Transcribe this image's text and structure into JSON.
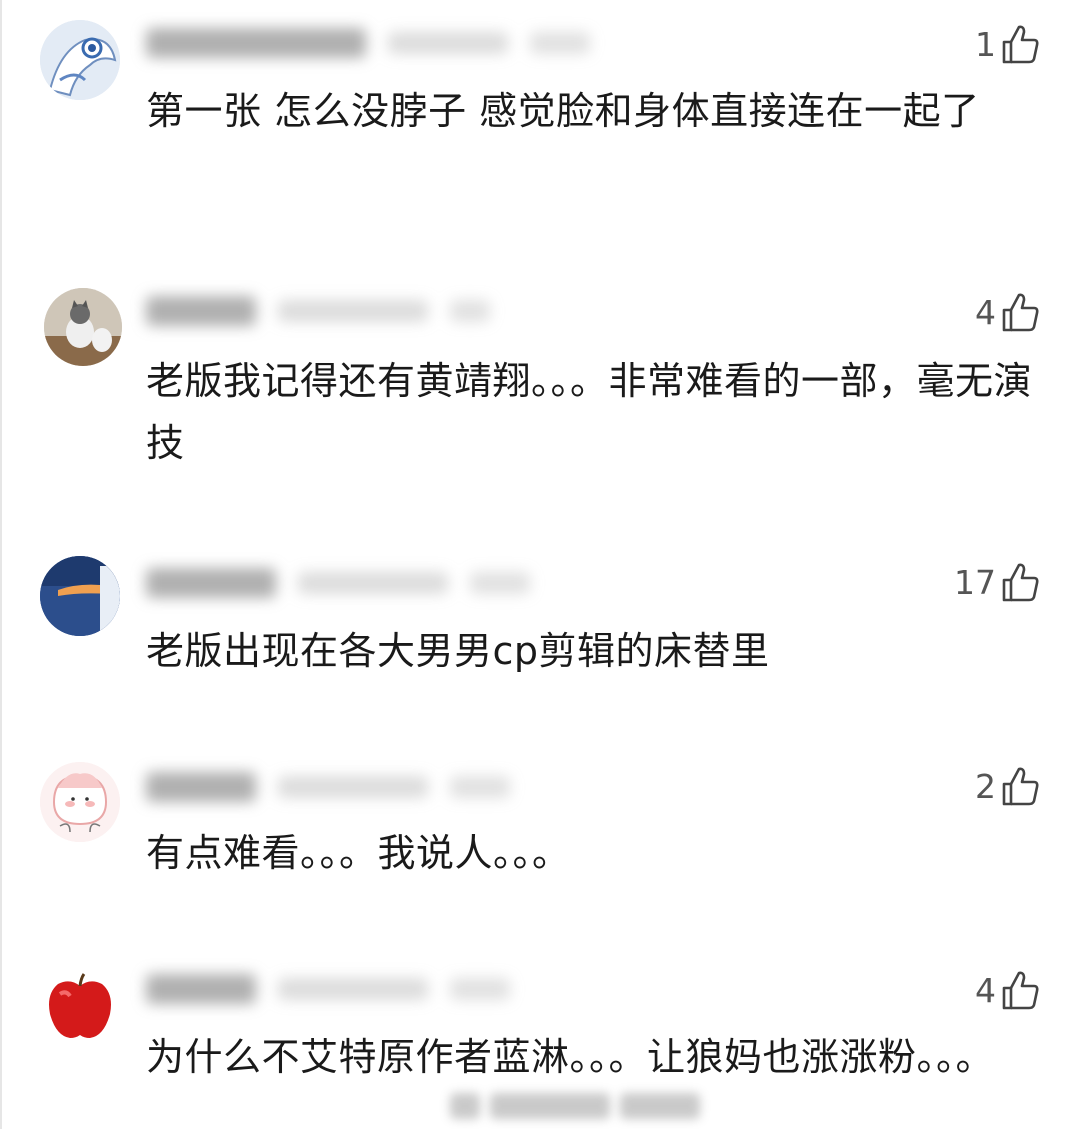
{
  "comments": [
    {
      "like_count": "1",
      "text": "第一张 怎么没脖子 感觉脸和身体直接连在一起了",
      "avatar": "blue-character-avatar"
    },
    {
      "like_count": "4",
      "text": "老版我记得还有黄靖翔。。。非常难看的一部，毫无演技",
      "avatar": "cat-photo-avatar"
    },
    {
      "like_count": "17",
      "text": "老版出现在各大男男cp剪辑的床替里",
      "avatar": "night-scene-avatar"
    },
    {
      "like_count": "2",
      "text": "有点难看。。。我说人。。。",
      "avatar": "cartoon-face-avatar"
    },
    {
      "like_count": "4",
      "text": "为什么不艾特原作者蓝淋。。。让狼妈也涨涨粉。。。",
      "avatar": "red-apple-avatar"
    }
  ],
  "icons": {
    "like": "thumbs-up-icon"
  },
  "colors": {
    "text": "#1a1a1a",
    "count": "#555555",
    "background": "#ffffff"
  }
}
